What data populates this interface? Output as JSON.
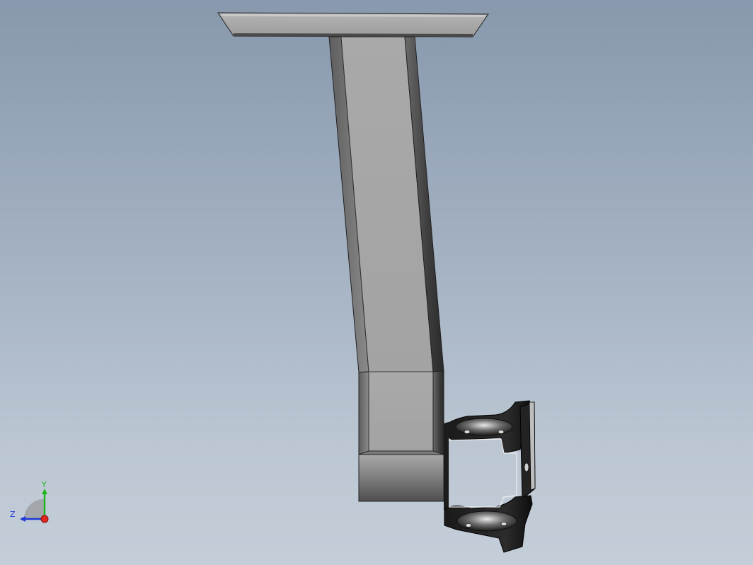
{
  "view": {
    "background_top": "#8898ad",
    "background_bottom": "#c4ced9",
    "model": "bracket-arm"
  },
  "triad": {
    "x_label": "",
    "y_label": "Y",
    "z_label": "Z",
    "x_color": "#e0261d",
    "y_color": "#1fb51f",
    "z_color": "#1f3ad6"
  }
}
